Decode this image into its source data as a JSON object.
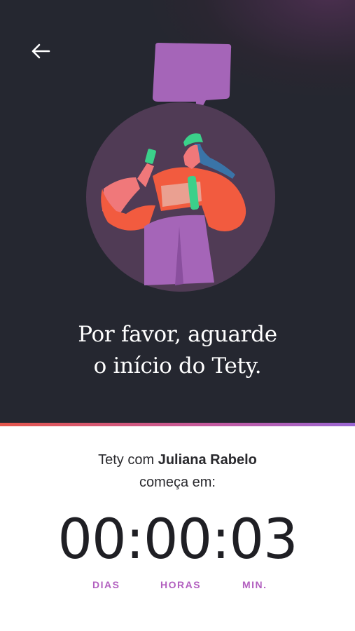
{
  "header": {
    "back_icon": "arrow-left-icon"
  },
  "hero": {
    "title_line1": "Por favor, aguarde",
    "title_line2": "o início do Tety."
  },
  "info": {
    "prefix": "Tety com ",
    "host": "Juliana Rabelo",
    "suffix": "começa em:"
  },
  "countdown": {
    "days": "00",
    "hours": "00",
    "minutes": "03",
    "separator": ":",
    "label_days": "DIAS",
    "label_hours": "HORAS",
    "label_minutes": "MIN."
  },
  "colors": {
    "background_dark": "#252730",
    "accent_purple": "#b25fbf",
    "accent_red": "#e5564b"
  }
}
